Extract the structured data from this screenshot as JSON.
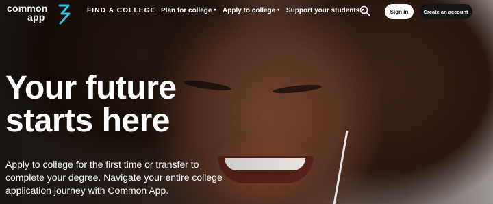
{
  "logo": {
    "line1": "common",
    "line2": "app",
    "accent": "#3ac1e8"
  },
  "nav": {
    "find_label": "FIND A COLLEGE",
    "items": [
      {
        "label": "Plan for college"
      },
      {
        "label": "Apply to college"
      },
      {
        "label": "Support your students"
      }
    ],
    "caret": "▾",
    "search_icon": "search-icon",
    "signin_label": "Sign in",
    "create_label": "Create an account"
  },
  "hero": {
    "headline_line1": "Your future",
    "headline_line2": "starts here",
    "subtext_line1": "Apply to college for the first time or transfer to",
    "subtext_line2": "complete your degree. Navigate your entire college",
    "subtext_line3": "application journey with Common App."
  }
}
